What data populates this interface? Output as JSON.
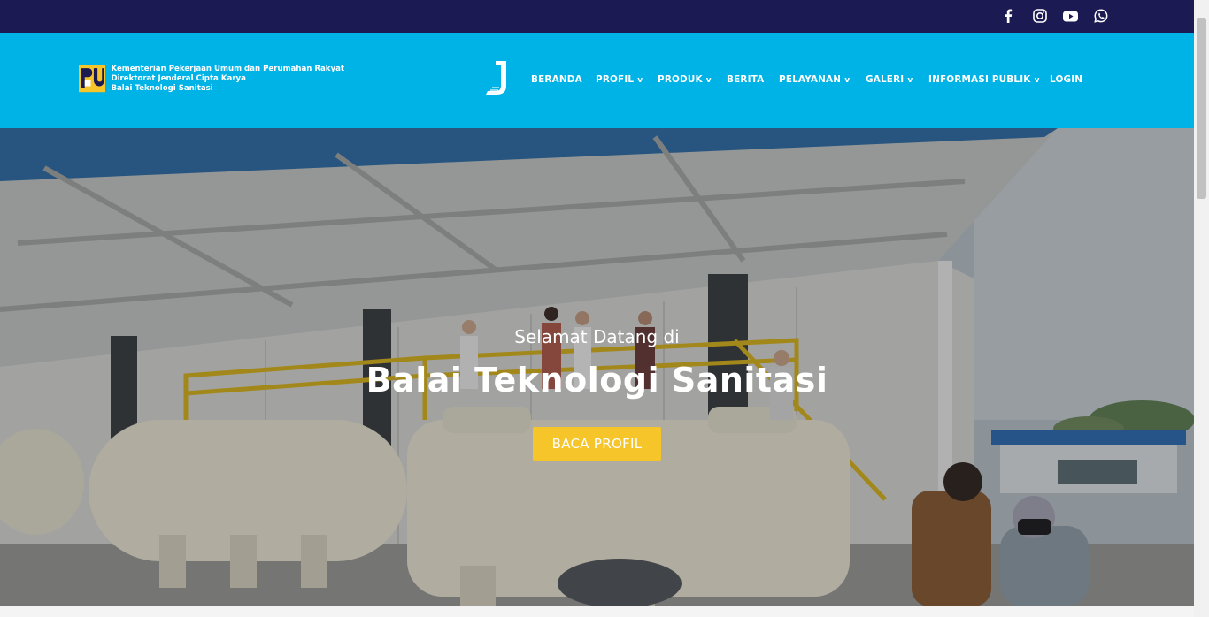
{
  "topbar": {
    "social": [
      {
        "icon": "facebook-icon",
        "label": "f"
      },
      {
        "icon": "instagram-icon",
        "label": ""
      },
      {
        "icon": "youtube-icon",
        "label": ""
      },
      {
        "icon": "whatsapp-icon",
        "label": ""
      }
    ]
  },
  "header": {
    "logo_lines": [
      "Kementerian Pekerjaan Umum dan Perumahan Rakyat",
      "Direktorat Jenderal Cipta Karya",
      "Balai Teknologi Sanitasi"
    ],
    "nav": [
      {
        "label": "BERANDA",
        "chevron": ""
      },
      {
        "label": "PROFIL",
        "chevron": "v"
      },
      {
        "label": "PRODUK",
        "chevron": "v"
      },
      {
        "label": "BERITA",
        "chevron": ""
      },
      {
        "label": "PELAYANAN",
        "chevron": "v"
      },
      {
        "label": "GALERI",
        "chevron": "v"
      },
      {
        "label": "INFORMASI PUBLIK",
        "chevron": "v"
      },
      {
        "label": "LOGIN",
        "chevron": ""
      }
    ]
  },
  "hero": {
    "kicker": "Selamat Datang di",
    "title": "Balai Teknologi Sanitasi",
    "button_label": "BACA PROFIL"
  },
  "colors": {
    "topbar": "#1b1a52",
    "header": "#00b3e6",
    "button": "#f5c52a"
  }
}
